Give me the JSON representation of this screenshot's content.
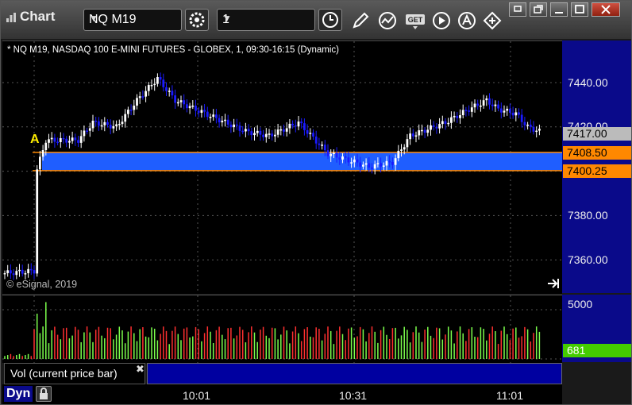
{
  "app": {
    "title": "Chart"
  },
  "toolbar": {
    "symbol": "NQ M19",
    "interval": "1"
  },
  "chart": {
    "subtitle": "* NQ M19, NASDAQ 100 E-MINI FUTURES - GLOBEX, 1, 09:30-16:15 (Dynamic)",
    "copyright": "© eSignal, 2019",
    "marker_label": "A",
    "price_ticks": [
      "7440.00",
      "7420.00",
      "7380.00",
      "7360.00"
    ],
    "last_price": "7417.00",
    "zone_high": "7408.50",
    "zone_low": "7400.25",
    "volume_tick": "5000",
    "volume_last": "681",
    "volume_panel_label": "Vol (current price bar)",
    "time_labels": [
      "10:01",
      "10:31",
      "11:01"
    ],
    "mode_label": "Dyn",
    "colors": {
      "up": "#ffffff",
      "down": "#1a1aff",
      "zone": "#1f5eff",
      "zone_line": "#ff8800",
      "vol_up": "#7cff4c",
      "vol_down": "#ff3030",
      "axis_bg": "#0a0a8a",
      "last_tag": "#bbbbbb",
      "vol_tag": "#44cc00"
    }
  }
}
